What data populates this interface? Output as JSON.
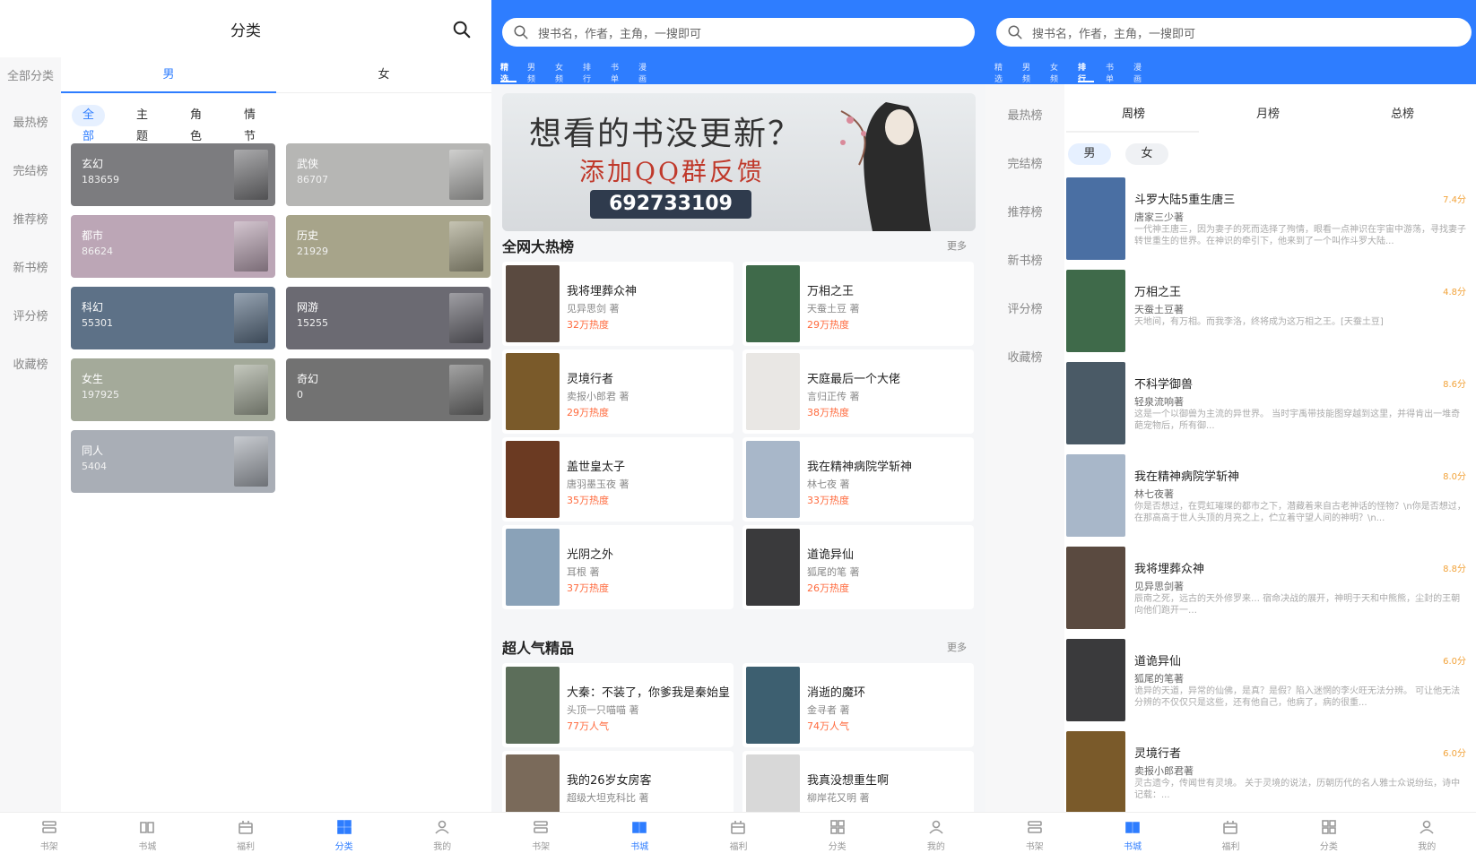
{
  "screen1": {
    "title": "分类",
    "sidebar": [
      "全部分类",
      "最热榜",
      "完结榜",
      "推荐榜",
      "新书榜",
      "评分榜",
      "收藏榜"
    ],
    "gender_tabs": [
      "男",
      "女"
    ],
    "chips": [
      "全部",
      "主题",
      "角色",
      "情节"
    ],
    "categories": [
      {
        "name": "玄幻",
        "count": "183659",
        "color": "#7c7c7f"
      },
      {
        "name": "武侠",
        "count": "86707",
        "color": "#b6b6b4"
      },
      {
        "name": "都市",
        "count": "86624",
        "color": "#bca6b6"
      },
      {
        "name": "历史",
        "count": "21929",
        "color": "#a7a48a"
      },
      {
        "name": "科幻",
        "count": "55301",
        "color": "#5d7187"
      },
      {
        "name": "网游",
        "count": "15255",
        "color": "#6b6a72"
      },
      {
        "name": "女生",
        "count": "197925",
        "color": "#a4aa9a"
      },
      {
        "name": "奇幻",
        "count": "0",
        "color": "#727272"
      },
      {
        "name": "同人",
        "count": "5404",
        "color": "#a9aeb6"
      }
    ]
  },
  "screen2": {
    "search_placeholder": "搜书名，作者，主角，一搜即可",
    "tabs": [
      "精选",
      "男频",
      "女频",
      "排行",
      "书单",
      "漫画"
    ],
    "banner": {
      "line1": "想看的书没更新？",
      "line2": "添加QQ群反馈",
      "number": "692733109"
    },
    "section1": {
      "title": "全网大热榜",
      "more": "更多"
    },
    "hot_books": [
      {
        "title": "我将埋葬众神",
        "author": "见异思剑 著",
        "heat": "32万热度",
        "color": "#5a4a40"
      },
      {
        "title": "万相之王",
        "author": "天蚕土豆 著",
        "heat": "29万热度",
        "color": "#3f6a4a"
      },
      {
        "title": "灵境行者",
        "author": "卖报小郎君 著",
        "heat": "29万热度",
        "color": "#7a5a2a"
      },
      {
        "title": "天庭最后一个大佬",
        "author": "言归正传 著",
        "heat": "38万热度",
        "color": "#e9e7e4"
      },
      {
        "title": "盖世皇太子",
        "author": "唐羽墨玉夜 著",
        "heat": "35万热度",
        "color": "#6b3a22"
      },
      {
        "title": "我在精神病院学斩神",
        "author": "林七夜 著",
        "heat": "33万热度",
        "color": "#a8b7c9"
      },
      {
        "title": "光阴之外",
        "author": "耳根 著",
        "heat": "37万热度",
        "color": "#8aa2b8"
      },
      {
        "title": "道诡异仙",
        "author": "狐尾的笔 著",
        "heat": "26万热度",
        "color": "#3a3a3c"
      }
    ],
    "section2": {
      "title": "超人气精品",
      "more": "更多"
    },
    "popular_books": [
      {
        "title": "大秦：不装了，你爹我是秦始皇",
        "author": "头顶一只喵喵 著",
        "heat": "77万人气",
        "color": "#5c6e5a"
      },
      {
        "title": "消逝的魔环",
        "author": "金寻者 著",
        "heat": "74万人气",
        "color": "#3d5f70"
      },
      {
        "title": "我的26岁女房客",
        "author": "超级大坦克科比 著",
        "heat": "",
        "color": "#7a6a5a"
      },
      {
        "title": "我真没想重生啊",
        "author": "柳岸花又明 著",
        "heat": "",
        "color": "#d8d8d8"
      }
    ]
  },
  "screen3": {
    "search_placeholder": "搜书名，作者，主角，一搜即可",
    "tabs": [
      "精选",
      "男频",
      "女频",
      "排行",
      "书单",
      "漫画"
    ],
    "sidebar": [
      "最热榜",
      "完结榜",
      "推荐榜",
      "新书榜",
      "评分榜",
      "收藏榜"
    ],
    "period_tabs": [
      "周榜",
      "月榜",
      "总榜"
    ],
    "gender_chips": [
      "男",
      "女"
    ],
    "ranking": [
      {
        "title": "斗罗大陆5重生唐三",
        "author": "唐家三少著",
        "score": "7.4分",
        "desc": "一代神王唐三，因为妻子的死而选择了殉情，眼看一点神识在宇宙中游荡，寻找妻子转世重生的世界。在神识的牵引下，他来到了一个叫作斗罗大陆...",
        "color": "#4a6fa3"
      },
      {
        "title": "万相之王",
        "author": "天蚕土豆著",
        "score": "4.8分",
        "desc": "天地间，有万相。而我李洛，终将成为这万相之王。[天蚕土豆]",
        "color": "#3f6a4a"
      },
      {
        "title": "不科学御兽",
        "author": "轻泉流响著",
        "score": "8.6分",
        "desc": "这是一个以御兽为主流的异世界。 当时宇禹带技能图穿越到这里，并得肯出一堆奇葩宠物后，所有御...",
        "color": "#4a5a66"
      },
      {
        "title": "我在精神病院学斩神",
        "author": "林七夜著",
        "score": "8.0分",
        "desc": "你是否想过，在霓虹璀璨的都市之下，潜藏着来自古老神话的怪物？\\n你是否想过，在那高高于世人头顶的月亮之上，伫立着守望人间的神明？\\n...",
        "color": "#a8b7c9"
      },
      {
        "title": "我将埋葬众神",
        "author": "见异思剑著",
        "score": "8.8分",
        "desc": "辰南之死，远古的天外修罗来… 宿命决战的展开，神明于天和中熊熊，尘封的王朝向他们跑开一…",
        "color": "#5a4a40"
      },
      {
        "title": "道诡异仙",
        "author": "狐尾的笔著",
        "score": "6.0分",
        "desc": "诡异的天道，异常的仙佛，是真？是假？陷入迷惘的李火旺无法分辨。 可让他无法分辨的不仅仅只是这些，还有他自己，他病了，病的很重...",
        "color": "#3a3a3c"
      },
      {
        "title": "灵境行者",
        "author": "卖报小郎君著",
        "score": "6.0分",
        "desc": "灵古遗今，传闻世有灵境。 关于灵境的说法，历朝历代的名人雅士众说纷纭，诗中记载：...",
        "color": "#7a5a2a"
      }
    ]
  },
  "bottom_nav": [
    "书架",
    "书城",
    "福利",
    "分类",
    "我的"
  ],
  "accent": "#2e7dff"
}
